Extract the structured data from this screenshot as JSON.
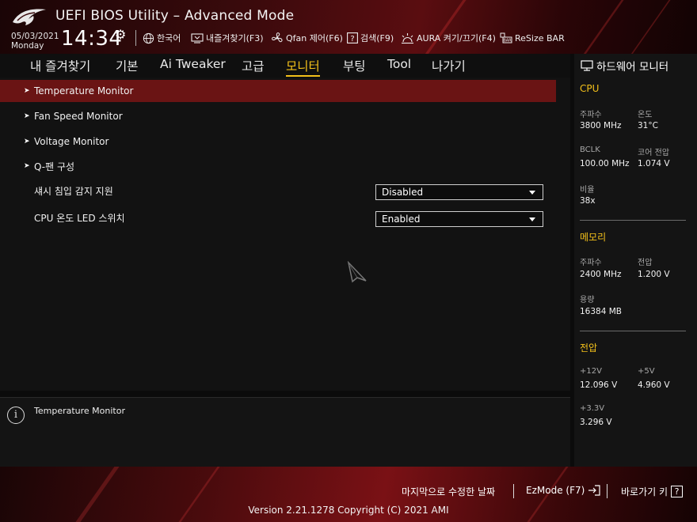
{
  "header": {
    "title": "UEFI BIOS Utility – Advanced Mode",
    "date": "05/03/2021",
    "weekday": "Monday",
    "time": "14:34",
    "items": [
      {
        "icon": "globe-icon",
        "label": "한국어"
      },
      {
        "icon": "favorites-icon",
        "label": "내즐겨찾기(F3)"
      },
      {
        "icon": "fan-icon",
        "label": "Qfan 제어(F6)"
      },
      {
        "icon": "help-search-icon",
        "label": "검색(F9)"
      },
      {
        "icon": "aura-icon",
        "label": "AURA 켜기/끄기(F4)"
      },
      {
        "icon": "resize-bar-icon",
        "label": "ReSize BAR"
      }
    ]
  },
  "tabs": [
    {
      "label": "내 즐겨찾기"
    },
    {
      "label": "기본"
    },
    {
      "label": "Ai Tweaker"
    },
    {
      "label": "고급"
    },
    {
      "label": "모니터",
      "active": true
    },
    {
      "label": "부팅"
    },
    {
      "label": "Tool"
    },
    {
      "label": "나가기"
    }
  ],
  "menu": [
    {
      "label": "Temperature Monitor",
      "submenu": true,
      "selected": true
    },
    {
      "label": "Fan Speed Monitor",
      "submenu": true
    },
    {
      "label": "Voltage Monitor",
      "submenu": true
    },
    {
      "label": "Q-팬 구성",
      "submenu": true
    }
  ],
  "settings": [
    {
      "label": "섀시 침입 감지 지원",
      "value": "Disabled"
    },
    {
      "label": "CPU 온도 LED 스위치",
      "value": "Enabled"
    }
  ],
  "help": {
    "text": "Temperature Monitor"
  },
  "hardware_monitor": {
    "title": "하드웨어 모니터",
    "cpu": {
      "heading": "CPU",
      "freq_label": "주파수",
      "freq_value": "3800 MHz",
      "temp_label": "온도",
      "temp_value": "31°C",
      "bclk_label": "BCLK",
      "bclk_value": "100.00 MHz",
      "core_volt_label": "코어 전압",
      "core_volt_value": "1.074 V",
      "ratio_label": "비율",
      "ratio_value": "38x"
    },
    "memory": {
      "heading": "메모리",
      "freq_label": "주파수",
      "freq_value": "2400 MHz",
      "volt_label": "전압",
      "volt_value": "1.200 V",
      "cap_label": "용량",
      "cap_value": "16384 MB"
    },
    "voltage": {
      "heading": "전압",
      "v12_label": "+12V",
      "v12_value": "12.096 V",
      "v5_label": "+5V",
      "v5_value": "4.960 V",
      "v33_label": "+3.3V",
      "v33_value": "3.296 V"
    }
  },
  "footer": {
    "last_modified": "마지막으로 수정한 날짜",
    "ezmode": "EzMode (F7)",
    "hotkeys": "바로가기 키",
    "hotkeys_key": "?",
    "version": "Version 2.21.1278 Copyright (C) 2021 AMI"
  },
  "colors": {
    "accent": "#f3c01a",
    "selected_row": "#6a1414",
    "brand_red": "#7a1115"
  }
}
